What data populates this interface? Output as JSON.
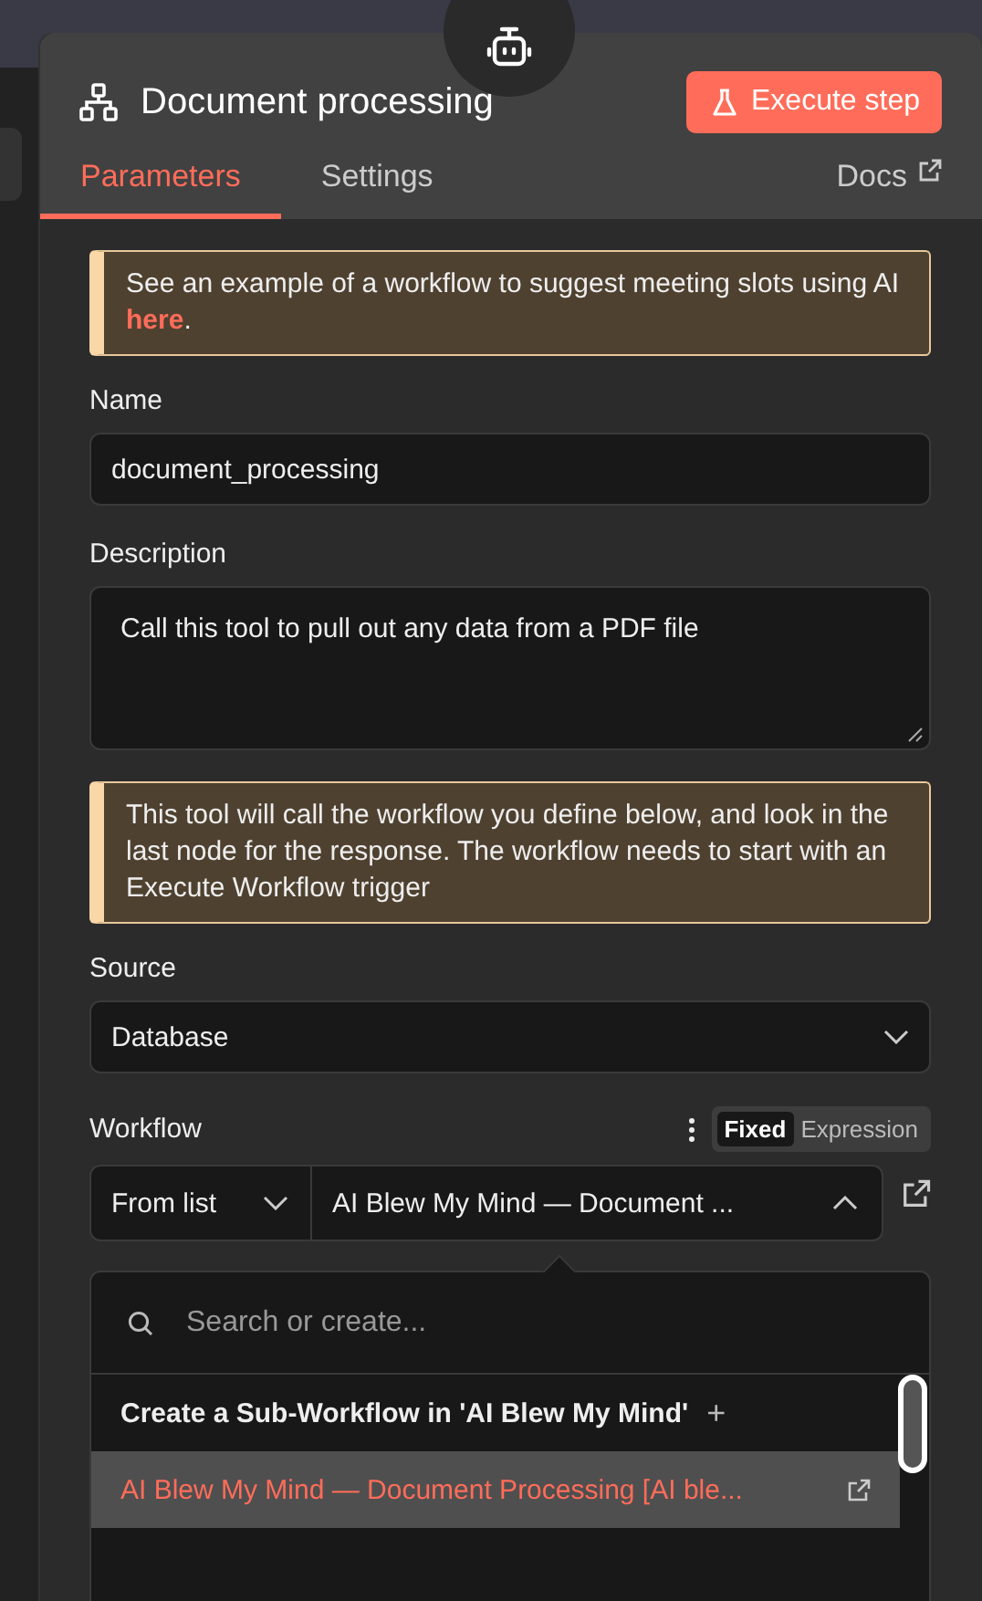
{
  "panel": {
    "title": "Document processing",
    "execute_button": "Execute step"
  },
  "tabs": [
    {
      "label": "Parameters",
      "selected": true
    },
    {
      "label": "Settings",
      "selected": false
    }
  ],
  "docs_link": "Docs",
  "example_notice": {
    "text": "See an example of a workflow to suggest meeting slots using AI",
    "link": "here",
    "after": "."
  },
  "name_field": {
    "label": "Name",
    "value": "document_processing"
  },
  "description_field": {
    "label": "Description",
    "value": "Call this tool to pull out any data from a PDF file"
  },
  "info_notice": "This tool will call the workflow you define below, and look in the last node for the response. The workflow needs to start with an Execute Workflow trigger",
  "source_field": {
    "label": "Source",
    "value": "Database"
  },
  "workflow_field": {
    "label": "Workflow",
    "modes": [
      {
        "label": "Fixed",
        "selected": true
      },
      {
        "label": "Expression",
        "selected": false
      }
    ],
    "mode_select": "From list",
    "value": "AI Blew My Mind — Document ...",
    "expanded": true
  },
  "dropdown": {
    "search_placeholder": "Search or create...",
    "create_label": "Create a Sub-Workflow in 'AI Blew My Mind'",
    "create_icon": "+",
    "items": [
      {
        "label": "AI Blew My Mind — Document Processing [AI ble...",
        "selected": true
      }
    ]
  }
}
